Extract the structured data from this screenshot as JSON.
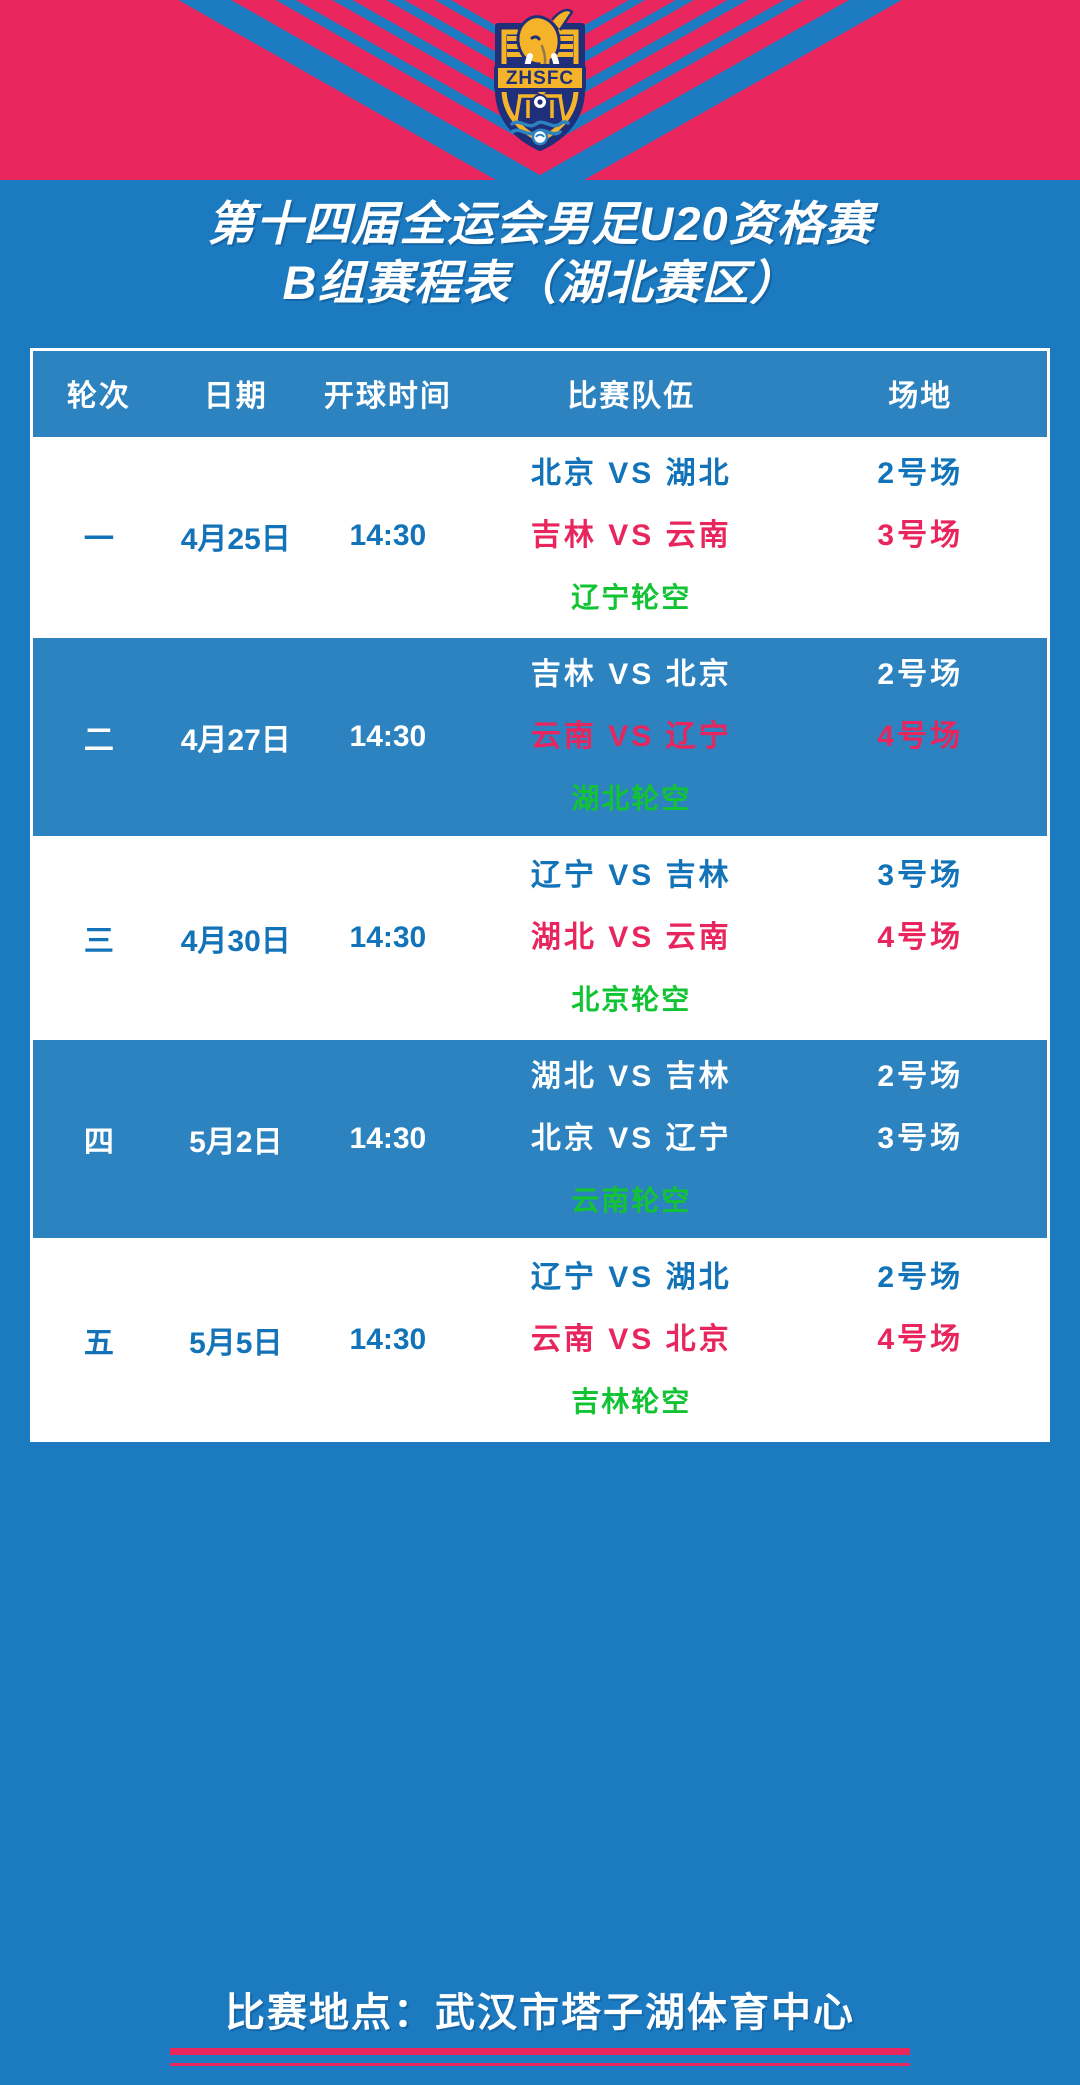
{
  "brand": {
    "crest_text": "ZHSFC",
    "colors": {
      "blue": "#1b7ac0",
      "table_blue": "#2d83c0",
      "pink": "#e8255c",
      "green": "#12c434",
      "navy": "#1f2f7a",
      "gold": "#f5b32a",
      "white": "#ffffff"
    }
  },
  "title": {
    "line1": "第十四届全运会男足U20资格赛",
    "line2": "B组赛程表（湖北赛区）"
  },
  "table": {
    "headers": [
      "轮次",
      "日期",
      "开球时间",
      "比赛队伍",
      "场地"
    ],
    "rows": [
      {
        "round": "一",
        "date": "4月25日",
        "time": "14:30",
        "shade": "light",
        "matches": [
          {
            "text": "北京 VS 湖北",
            "home": "北京",
            "away": "湖北",
            "venue": "2号场",
            "color": "blue"
          },
          {
            "text": "吉林 VS 云南",
            "home": "吉林",
            "away": "云南",
            "venue": "3号场",
            "color": "red"
          }
        ],
        "bye": "辽宁轮空",
        "bye_team": "辽宁"
      },
      {
        "round": "二",
        "date": "4月27日",
        "time": "14:30",
        "shade": "dark",
        "matches": [
          {
            "text": "吉林 VS 北京",
            "home": "吉林",
            "away": "北京",
            "venue": "2号场",
            "color": "white"
          },
          {
            "text": "云南 VS 辽宁",
            "home": "云南",
            "away": "辽宁",
            "venue": "4号场",
            "color": "red"
          }
        ],
        "bye": "湖北轮空",
        "bye_team": "湖北"
      },
      {
        "round": "三",
        "date": "4月30日",
        "time": "14:30",
        "shade": "light",
        "matches": [
          {
            "text": "辽宁 VS 吉林",
            "home": "辽宁",
            "away": "吉林",
            "venue": "3号场",
            "color": "blue"
          },
          {
            "text": "湖北 VS 云南",
            "home": "湖北",
            "away": "云南",
            "venue": "4号场",
            "color": "red"
          }
        ],
        "bye": "北京轮空",
        "bye_team": "北京"
      },
      {
        "round": "四",
        "date": "5月2日",
        "time": "14:30",
        "shade": "dark",
        "matches": [
          {
            "text": "湖北 VS 吉林",
            "home": "湖北",
            "away": "吉林",
            "venue": "2号场",
            "color": "white"
          },
          {
            "text": "北京 VS 辽宁",
            "home": "北京",
            "away": "辽宁",
            "venue": "3号场",
            "color": "white"
          }
        ],
        "bye": "云南轮空",
        "bye_team": "云南"
      },
      {
        "round": "五",
        "date": "5月5日",
        "time": "14:30",
        "shade": "light",
        "matches": [
          {
            "text": "辽宁 VS 湖北",
            "home": "辽宁",
            "away": "湖北",
            "venue": "2号场",
            "color": "blue"
          },
          {
            "text": "云南 VS 北京",
            "home": "云南",
            "away": "北京",
            "venue": "4号场",
            "color": "red"
          }
        ],
        "bye": "吉林轮空",
        "bye_team": "吉林"
      }
    ]
  },
  "footer": {
    "venue_text": "比赛地点：武汉市塔子湖体育中心"
  }
}
